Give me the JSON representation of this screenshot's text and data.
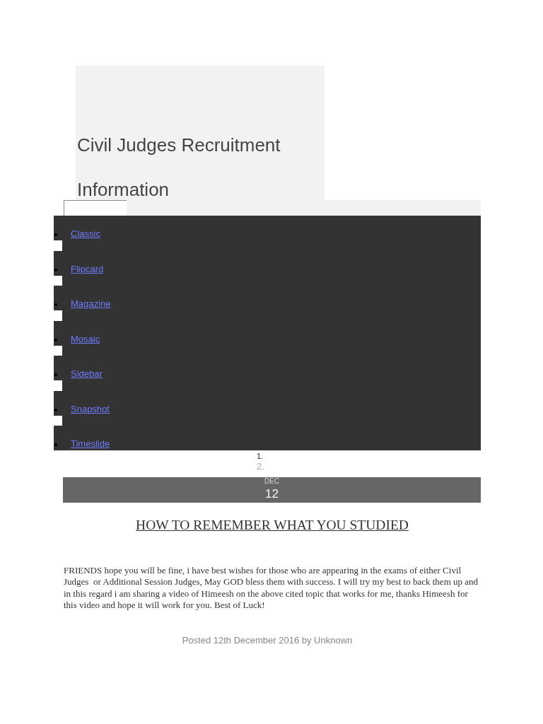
{
  "blog": {
    "title": "Civil Judges Recruitment Information"
  },
  "nav": {
    "items": [
      "Classic",
      "Flipcard",
      "Magazine",
      "Mosaic",
      "Sidebar",
      "Snapshot",
      "Timeslide"
    ]
  },
  "pager": [
    {
      "label": "1.",
      "disabled": false
    },
    {
      "label": "2.",
      "disabled": true
    }
  ],
  "post": {
    "date": {
      "month": "DEC",
      "day": "12"
    },
    "title": "HOW TO REMEMBER WHAT YOU STUDIED",
    "body": "FRIENDS hope you will be fine, i have best wishes for those who are appearing in the exams of either Civil Judges  or Additional Session Judges, May GOD bless them with success. I will try my best to back them up and in this regard i am sharing a video of Himeesh on the above cited topic that works for me, thanks Himeesh for this video and hope it will work for you. Best of Luck!",
    "footer": "Posted 12th December 2016 by Unknown"
  }
}
